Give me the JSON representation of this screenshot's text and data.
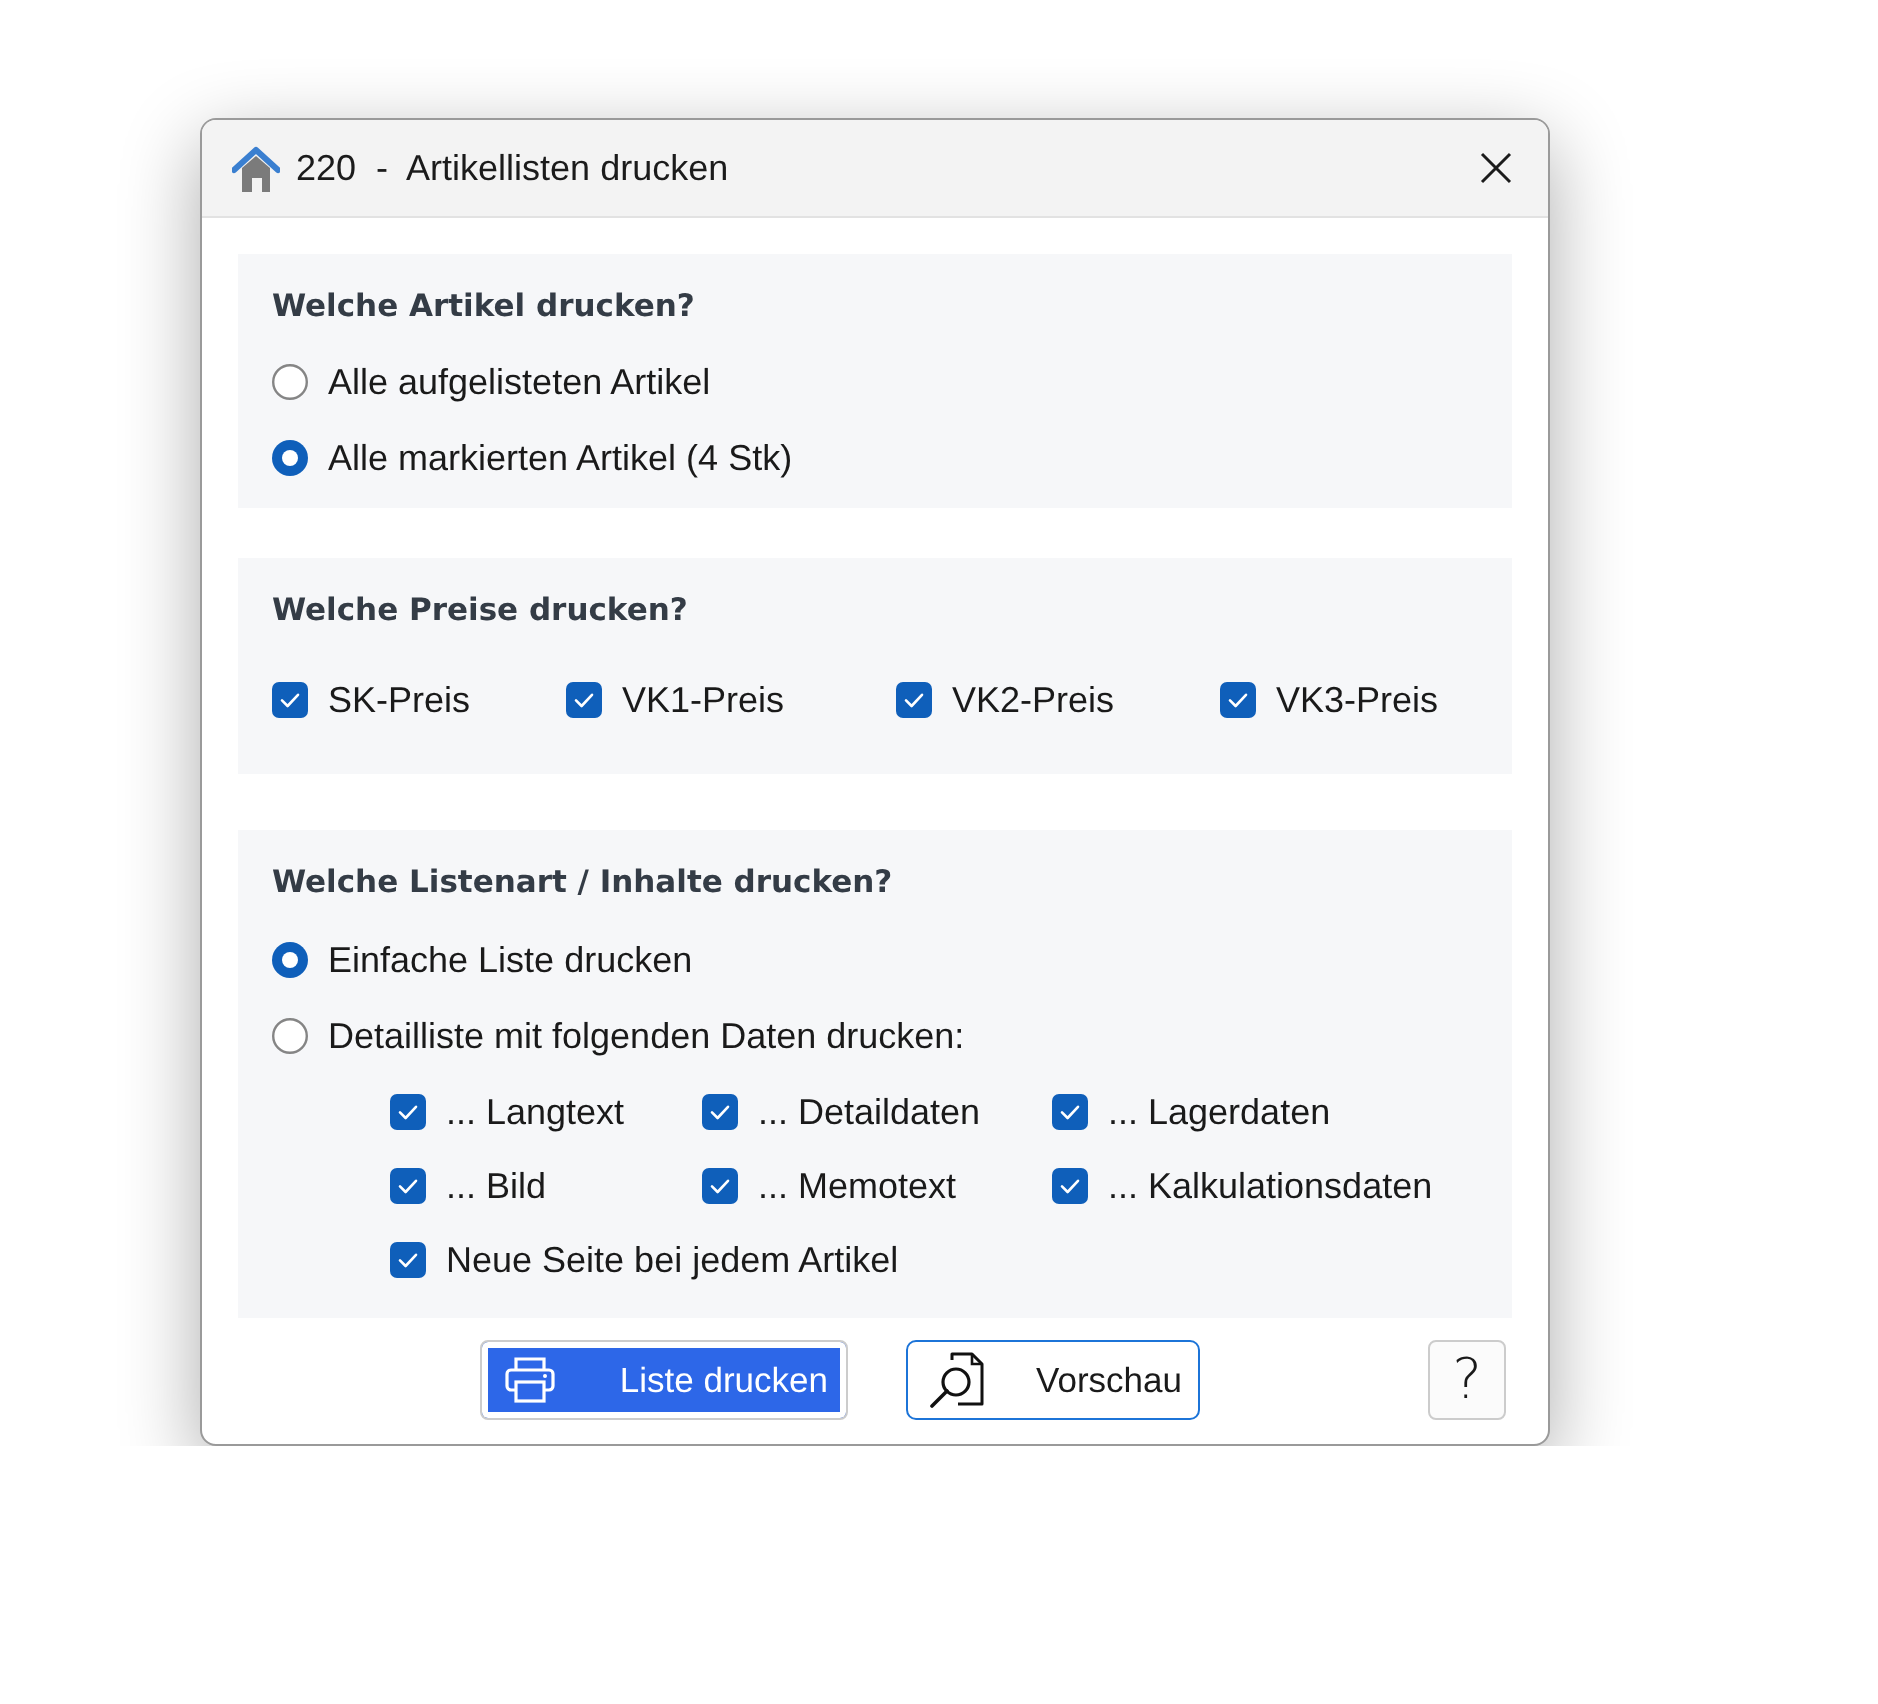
{
  "window": {
    "title": "220  -  Artikellisten drucken"
  },
  "sections": [
    {
      "heading": "Welche Artikel drucken?",
      "items": [
        {
          "kind": "radio",
          "label": "Alle aufgelisteten Artikel",
          "selected": false
        },
        {
          "kind": "radio",
          "label": "Alle markierten Artikel (4 Stk)",
          "selected": true
        }
      ]
    },
    {
      "heading": "Welche Preise drucken?",
      "items": [
        {
          "kind": "checkbox_row",
          "checkboxes": [
            {
              "label": "SK-Preis",
              "checked": true
            },
            {
              "label": "VK1-Preis",
              "checked": true
            },
            {
              "label": "VK2-Preis",
              "checked": true
            },
            {
              "label": "VK3-Preis",
              "checked": true
            }
          ]
        }
      ]
    },
    {
      "heading": "Welche Listenart / Inhalte drucken?",
      "items": [
        {
          "kind": "radio",
          "label": "Einfache Liste drucken",
          "selected": true
        },
        {
          "kind": "radio",
          "label": "Detailliste mit folgenden Daten drucken:",
          "selected": false
        },
        {
          "kind": "checkbox_grid",
          "checkboxes": [
            {
              "label": "... Langtext",
              "checked": true
            },
            {
              "label": "... Detaildaten",
              "checked": true
            },
            {
              "label": "... Lagerdaten",
              "checked": true
            },
            {
              "label": "... Bild",
              "checked": true
            },
            {
              "label": "... Memotext",
              "checked": true
            },
            {
              "label": "... Kalkulationsdaten",
              "checked": true
            },
            {
              "label": "Neue Seite bei jedem Artikel",
              "checked": true
            }
          ]
        }
      ]
    }
  ],
  "buttons": [
    {
      "kind": "primary",
      "label": "Liste drucken"
    },
    {
      "kind": "preview",
      "label": "Vorschau"
    },
    {
      "kind": "help",
      "label": "?"
    }
  ]
}
